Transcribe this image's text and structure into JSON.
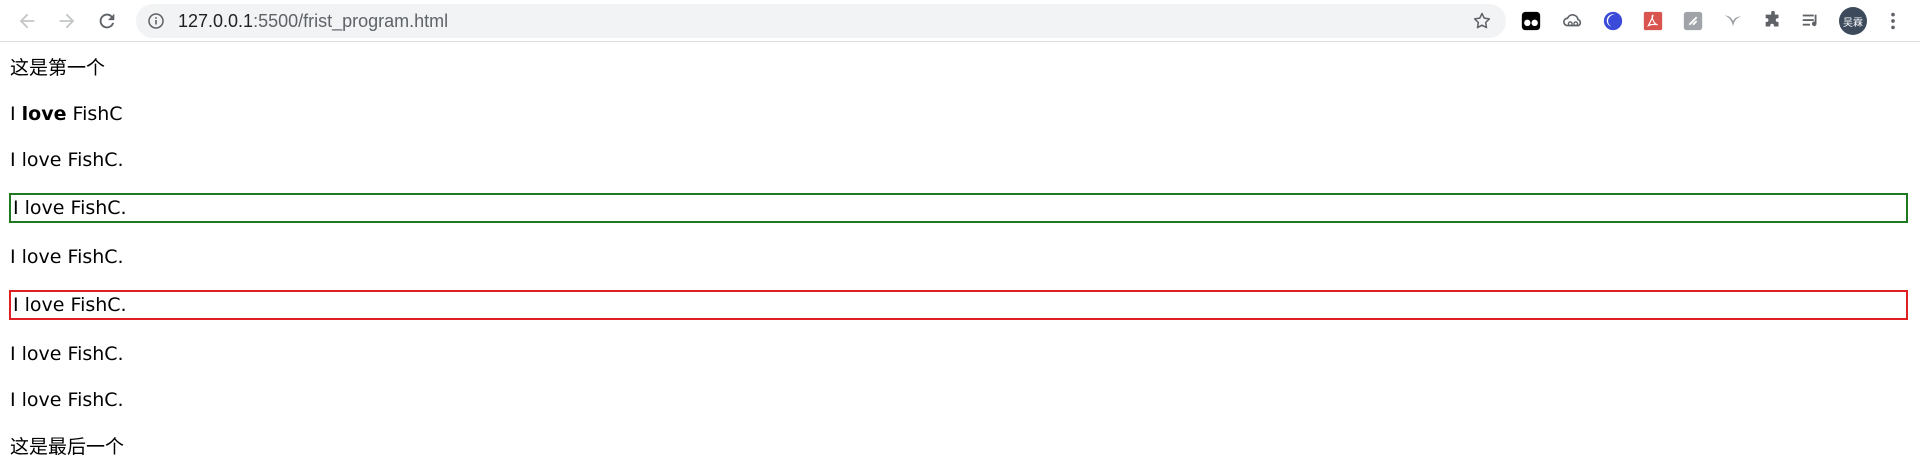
{
  "browser": {
    "url_host": "127.0.0.1",
    "url_path": ":5500/frist_program.html",
    "avatar_label": "吴霖",
    "icons": {
      "back": "back-arrow-icon",
      "forward": "forward-arrow-icon",
      "reload": "reload-icon",
      "site_info": "info-icon",
      "bookmark": "star-icon",
      "extensions": [
        "tampermonkey-icon",
        "cloud-sync-icon",
        "blue-extension-icon",
        "pdf-icon",
        "gray-extension-icon",
        "bird-icon",
        "puzzle-icon",
        "reading-list-icon"
      ],
      "menu": "kebab-menu-icon"
    },
    "colors": {
      "green_border": "#1f7a1f",
      "red_border": "#e02020"
    }
  },
  "page": {
    "first_line": "这是第一个",
    "bold_line": {
      "pre": "I ",
      "bold": "love",
      "post": " FishC"
    },
    "lines": [
      "I love FishC.",
      "I love FishC.",
      "I love FishC.",
      "I love FishC.",
      "I love FishC.",
      "I love FishC."
    ],
    "last_line": "这是最后一个"
  }
}
